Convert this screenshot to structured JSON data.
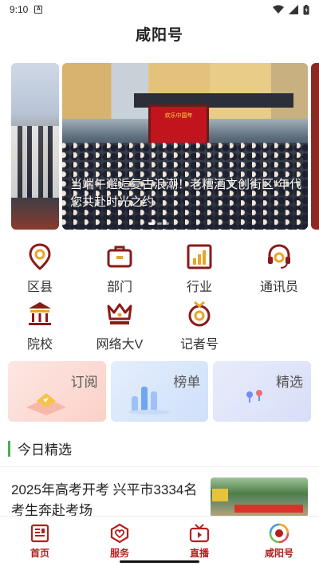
{
  "status_bar": {
    "time": "9:10",
    "notif_letter": "A"
  },
  "app": {
    "title": "咸阳号"
  },
  "carousel": {
    "caption_line1": "当端午邂逅复古浪潮！老糟酒文创街区“年代",
    "caption_line2": "您共赴时光之约",
    "stage_sign": "欢乐中国年",
    "dot_count": 3,
    "active_dot": 0
  },
  "grid": [
    {
      "label": "区县",
      "icon": "location-icon"
    },
    {
      "label": "部门",
      "icon": "briefcase-icon"
    },
    {
      "label": "行业",
      "icon": "bar-chart-icon"
    },
    {
      "label": "通讯员",
      "icon": "headset-icon"
    },
    {
      "label": "院校",
      "icon": "institution-icon"
    },
    {
      "label": "网络大V",
      "icon": "crown-icon"
    },
    {
      "label": "记者号",
      "icon": "medal-icon"
    }
  ],
  "cards": [
    {
      "label": "订阅",
      "icon": "subscribe-illustration"
    },
    {
      "label": "榜单",
      "icon": "ranking-illustration"
    },
    {
      "label": "精选",
      "icon": "featured-illustration"
    }
  ],
  "section": {
    "title": "今日精选",
    "accent": "#4caf50"
  },
  "news": {
    "title": "2025年高考开考 兴平市3334名考生奔赴考场"
  },
  "tabs": [
    {
      "label": "首页",
      "icon": "news-icon"
    },
    {
      "label": "服务",
      "icon": "heart-service-icon"
    },
    {
      "label": "直播",
      "icon": "tv-icon"
    },
    {
      "label": "咸阳号",
      "icon": "xianyang-logo-icon"
    }
  ],
  "colors": {
    "brand": "#b4201e",
    "icon_stroke": "#8a1a18",
    "icon_fill": "#e8a52a"
  }
}
